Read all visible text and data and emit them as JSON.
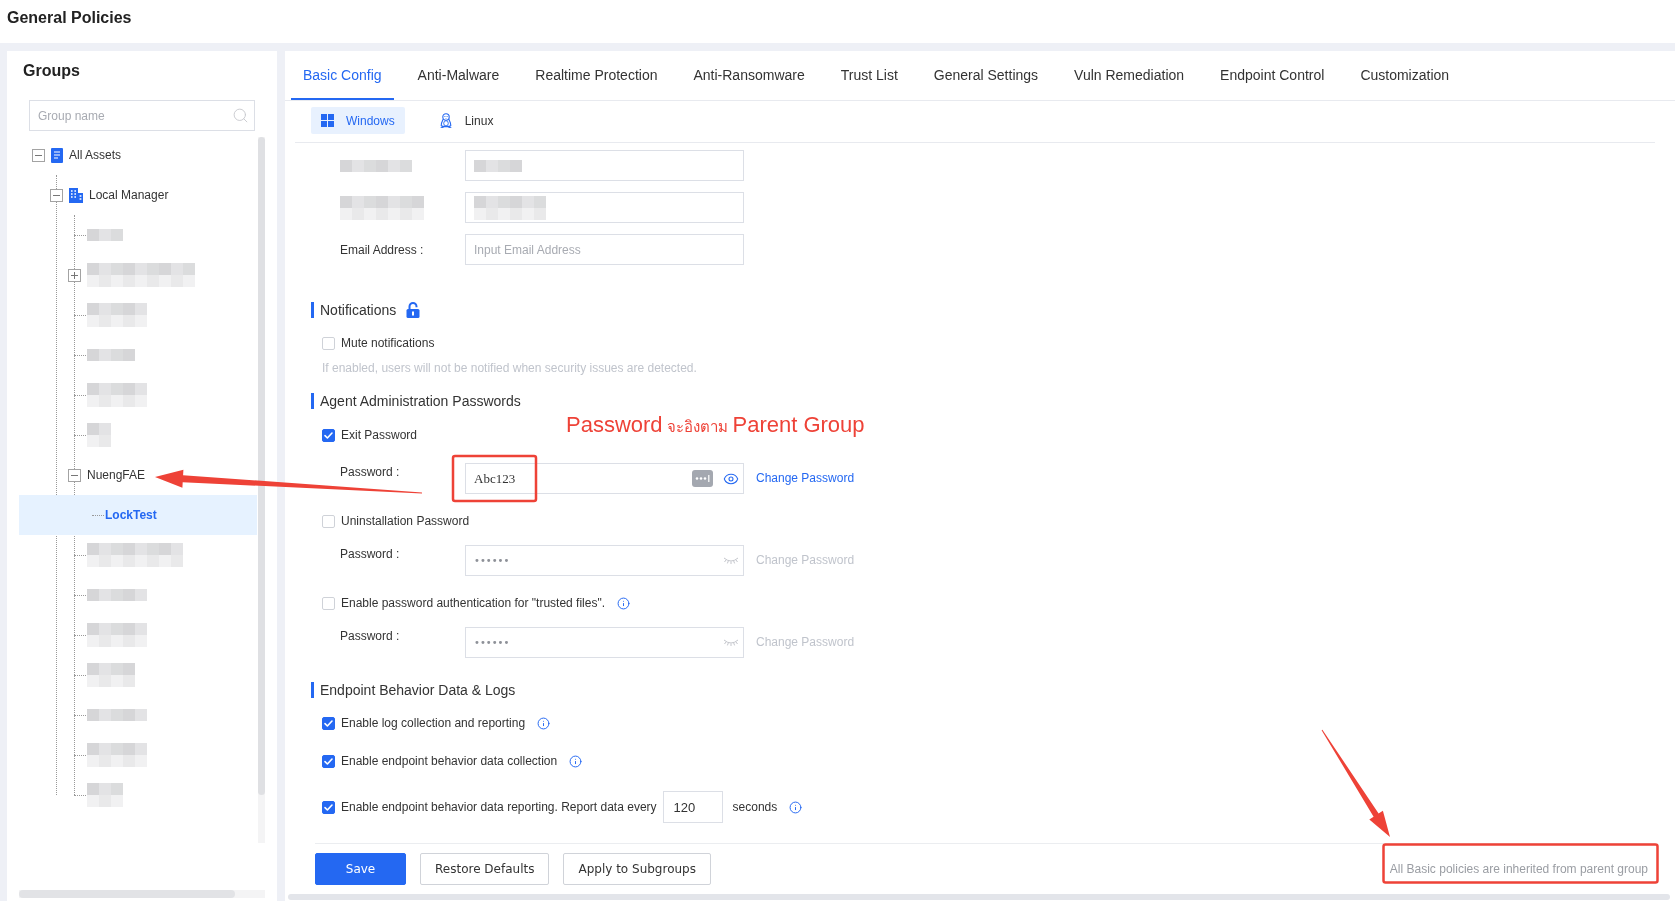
{
  "header": {
    "title": "General Policies"
  },
  "sidebar": {
    "title": "Groups",
    "search": {
      "placeholder": "Group name"
    },
    "tree": [
      {
        "kind": "group",
        "label": "All Assets",
        "expanded": true,
        "selected": false,
        "children": [
          {
            "kind": "group",
            "label": "Local Manager",
            "expanded": true,
            "selected": false,
            "children": [
              {
                "kind": "redacted",
                "selected": false
              },
              {
                "kind": "redacted",
                "expanded": false,
                "selected": false
              },
              {
                "kind": "redacted",
                "selected": false
              },
              {
                "kind": "redacted",
                "selected": false
              },
              {
                "kind": "redacted",
                "selected": false
              },
              {
                "kind": "redacted",
                "selected": false
              },
              {
                "kind": "group",
                "label": "NuengFAE",
                "expanded": true,
                "selected": false,
                "children": [
                  {
                    "kind": "group",
                    "label": "LockTest",
                    "selected": true
                  }
                ]
              },
              {
                "kind": "redacted",
                "selected": false
              },
              {
                "kind": "redacted",
                "selected": false
              },
              {
                "kind": "redacted",
                "selected": false
              },
              {
                "kind": "redacted",
                "selected": false
              },
              {
                "kind": "redacted",
                "selected": false
              },
              {
                "kind": "redacted",
                "selected": false
              },
              {
                "kind": "redacted",
                "selected": false
              }
            ]
          }
        ]
      }
    ]
  },
  "tabs": [
    {
      "label": "Basic Config",
      "selected": true
    },
    {
      "label": "Anti-Malware",
      "selected": false
    },
    {
      "label": "Realtime Protection",
      "selected": false
    },
    {
      "label": "Anti-Ransomware",
      "selected": false
    },
    {
      "label": "Trust List",
      "selected": false
    },
    {
      "label": "General Settings",
      "selected": false
    },
    {
      "label": "Vuln Remediation",
      "selected": false
    },
    {
      "label": "Endpoint Control",
      "selected": false
    },
    {
      "label": "Customization",
      "selected": false
    }
  ],
  "platforms": [
    {
      "label": "Windows",
      "selected": true
    },
    {
      "label": "Linux",
      "selected": false
    }
  ],
  "fields": [
    {
      "kind": "redacted"
    },
    {
      "kind": "redacted"
    },
    {
      "kind": "email",
      "label": "Email Address :",
      "placeholder": "Input Email Address"
    }
  ],
  "sections": [
    {
      "title": "Notifications",
      "locked": false,
      "items": [
        {
          "kind": "check",
          "label": "Mute notifications",
          "checked": false,
          "hint": "If enabled, users will not be notified when security issues are detected."
        }
      ]
    },
    {
      "title": "Agent Administration Passwords",
      "items": [
        {
          "kind": "password",
          "label": "Exit Password",
          "checked": true,
          "field": {
            "label": "Password :",
            "value": "Abc123",
            "disabled": false,
            "revealed": true,
            "link": "Change Password"
          }
        },
        {
          "kind": "password",
          "label": "Uninstallation Password",
          "checked": false,
          "field": {
            "label": "Password :",
            "value": "••••••",
            "disabled": true,
            "revealed": false,
            "link": "Change Password"
          }
        },
        {
          "kind": "password",
          "label": "Enable password authentication for \"trusted files\".",
          "checked": false,
          "info": true,
          "field": {
            "label": "Password :",
            "value": "••••••",
            "disabled": true,
            "revealed": false,
            "link": "Change Password"
          }
        }
      ]
    },
    {
      "title": "Endpoint Behavior Data & Logs",
      "items": [
        {
          "kind": "check",
          "label": "Enable log collection and reporting",
          "checked": true,
          "info": true
        },
        {
          "kind": "check",
          "label": "Enable endpoint behavior data collection",
          "checked": true,
          "info": true
        },
        {
          "kind": "interval",
          "label": "Enable endpoint behavior data reporting. Report data every",
          "checked": true,
          "value": "120",
          "unit": "seconds",
          "info": true
        }
      ]
    }
  ],
  "footer": {
    "buttons": [
      {
        "label": "Save",
        "kind": "primary"
      },
      {
        "label": "Restore Defaults",
        "kind": "default"
      },
      {
        "label": "Apply to Subgroups",
        "kind": "default"
      }
    ],
    "note": "All Basic policies are inherited from parent group"
  },
  "annotation": {
    "callout": [
      {
        "text": "Password",
        "kind": "large"
      },
      {
        "text": "จะอิงตาม",
        "kind": "small"
      },
      {
        "text": "Parent Group",
        "kind": "large"
      }
    ]
  }
}
